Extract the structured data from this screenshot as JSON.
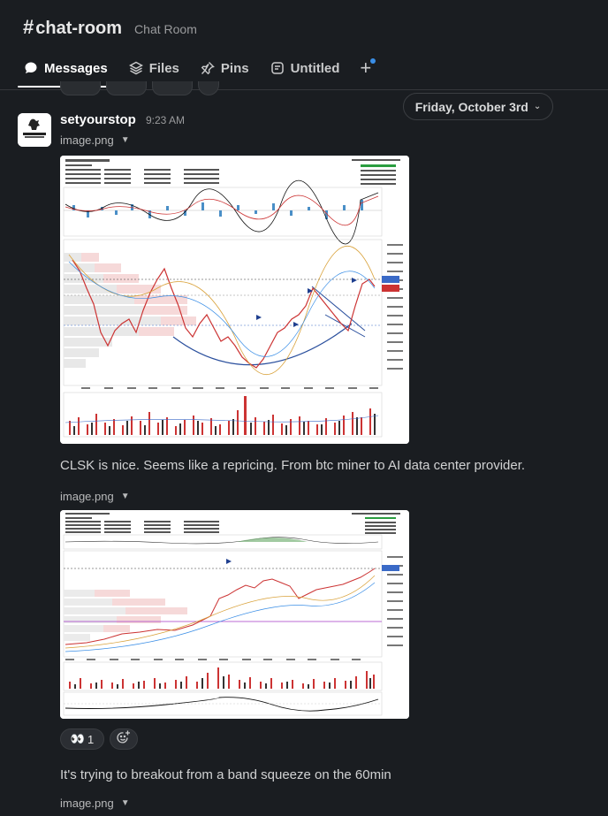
{
  "channel": {
    "hash": "#",
    "name": "chat-room",
    "topic": "Chat Room"
  },
  "tabs": [
    {
      "label": "Messages",
      "icon": "message-icon",
      "active": true
    },
    {
      "label": "Files",
      "icon": "files-icon",
      "active": false
    },
    {
      "label": "Pins",
      "icon": "pin-icon",
      "active": false
    },
    {
      "label": "Untitled",
      "icon": "canvas-icon",
      "active": false
    }
  ],
  "add_tab_label": "+",
  "date_divider": "Friday, October 3rd",
  "message": {
    "author": "setyourstop",
    "time": "9:23 AM",
    "attachments": [
      {
        "file_name": "image.png"
      },
      {
        "file_name": "image.png"
      },
      {
        "file_name": "image.png"
      }
    ],
    "texts": [
      "CLSK is nice. Seems like a repricing. From btc miner to AI data center provider.",
      "It's trying to breakout from a band squeeze on the 60min"
    ],
    "reaction": {
      "emoji": "👀",
      "count": "1"
    }
  },
  "colors": {
    "background": "#1a1d21",
    "accent_blue": "#3a8ee6"
  }
}
